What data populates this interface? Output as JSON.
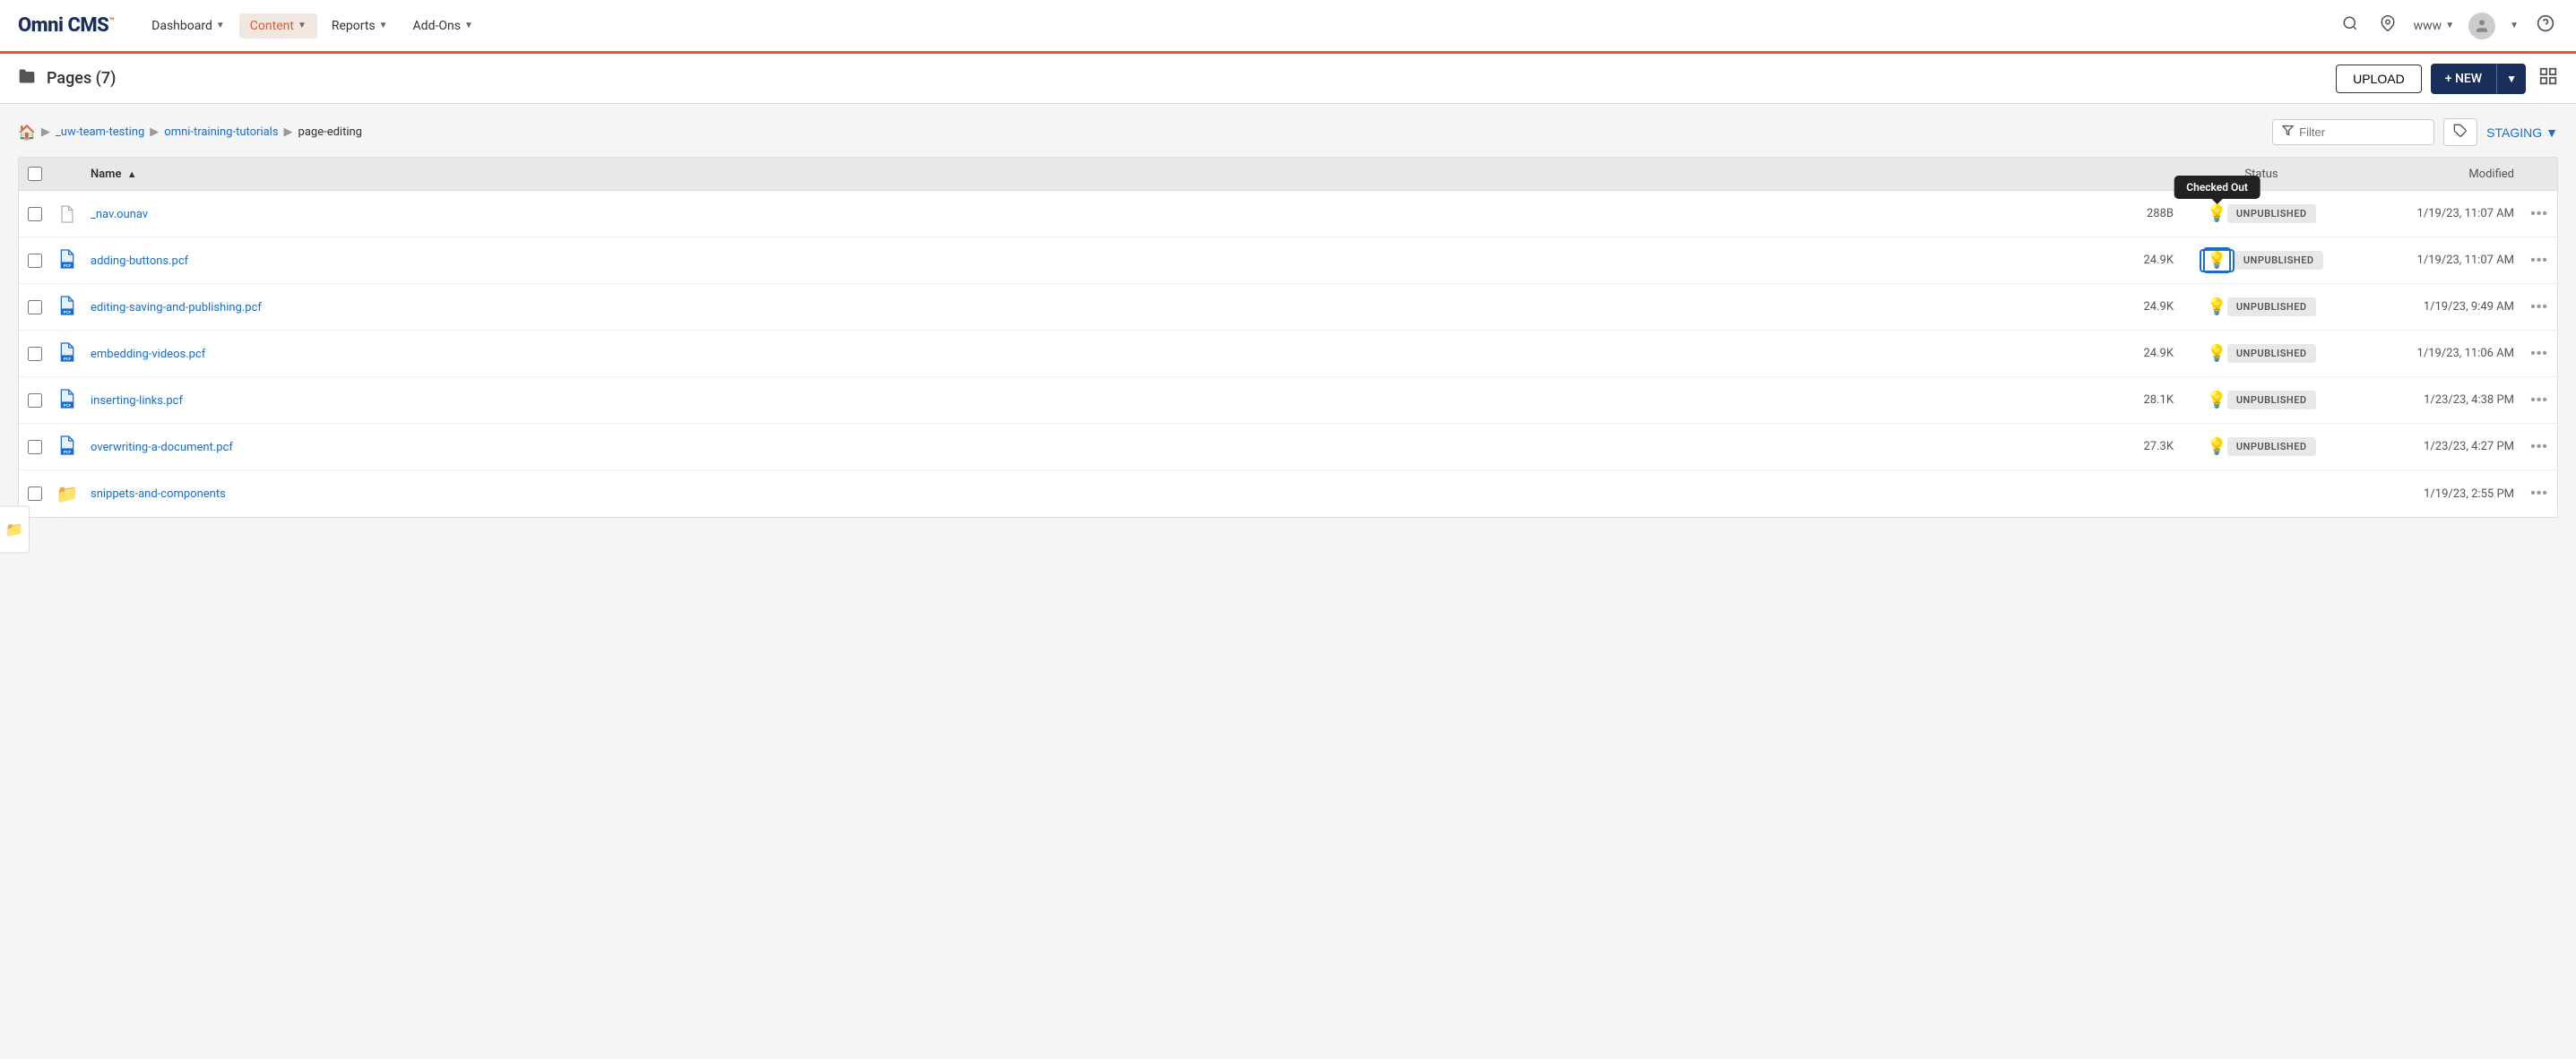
{
  "logo": {
    "text": "Omni CMS",
    "tm": "™"
  },
  "nav": {
    "items": [
      {
        "label": "Dashboard",
        "hasArrow": true,
        "active": false
      },
      {
        "label": "Content",
        "hasArrow": true,
        "active": true
      },
      {
        "label": "Reports",
        "hasArrow": true,
        "active": false
      },
      {
        "label": "Add-Ons",
        "hasArrow": true,
        "active": false
      }
    ],
    "right": {
      "www": "www",
      "help": "?"
    }
  },
  "pageHeader": {
    "title": "Pages (7)",
    "uploadLabel": "UPLOAD",
    "newLabel": "+ NEW"
  },
  "breadcrumb": {
    "home": "🏠",
    "items": [
      {
        "label": "_uw-team-testing",
        "link": true
      },
      {
        "label": "omni-training-tutorials",
        "link": true
      },
      {
        "label": "page-editing",
        "link": false
      }
    ]
  },
  "filter": {
    "placeholder": "Filter",
    "label": "Filter"
  },
  "staging": {
    "label": "STAGING"
  },
  "tableHeader": {
    "name": "Name",
    "sortIcon": "▲",
    "status": "Status",
    "modified": "Modified"
  },
  "files": [
    {
      "id": 1,
      "name": "_nav.ounav",
      "type": "plain",
      "size": "288B",
      "checkedOut": true,
      "showTooltip": true,
      "tooltipText": "Checked Out",
      "status": "UNPUBLISHED",
      "modified": "1/19/23, 11:07 AM"
    },
    {
      "id": 2,
      "name": "adding-buttons.pcf",
      "type": "pcf",
      "size": "24.9K",
      "checkedOut": true,
      "showTooltip": false,
      "highlighted": true,
      "status": "UNPUBLISHED",
      "modified": "1/19/23, 11:07 AM"
    },
    {
      "id": 3,
      "name": "editing-saving-and-publishing.pcf",
      "type": "pcf",
      "size": "24.9K",
      "checkedOut": false,
      "showTooltip": false,
      "status": "UNPUBLISHED",
      "modified": "1/19/23, 9:49 AM"
    },
    {
      "id": 4,
      "name": "embedding-videos.pcf",
      "type": "pcf",
      "size": "24.9K",
      "checkedOut": false,
      "showTooltip": false,
      "status": "UNPUBLISHED",
      "modified": "1/19/23, 11:06 AM"
    },
    {
      "id": 5,
      "name": "inserting-links.pcf",
      "type": "pcf",
      "size": "28.1K",
      "checkedOut": false,
      "showTooltip": false,
      "status": "UNPUBLISHED",
      "modified": "1/23/23, 4:38 PM"
    },
    {
      "id": 6,
      "name": "overwriting-a-document.pcf",
      "type": "pcf",
      "size": "27.3K",
      "checkedOut": false,
      "showTooltip": false,
      "status": "UNPUBLISHED",
      "modified": "1/23/23, 4:27 PM"
    },
    {
      "id": 7,
      "name": "snippets-and-components",
      "type": "folder",
      "size": "",
      "checkedOut": false,
      "showTooltip": false,
      "status": "",
      "modified": "1/19/23, 2:55 PM"
    }
  ]
}
